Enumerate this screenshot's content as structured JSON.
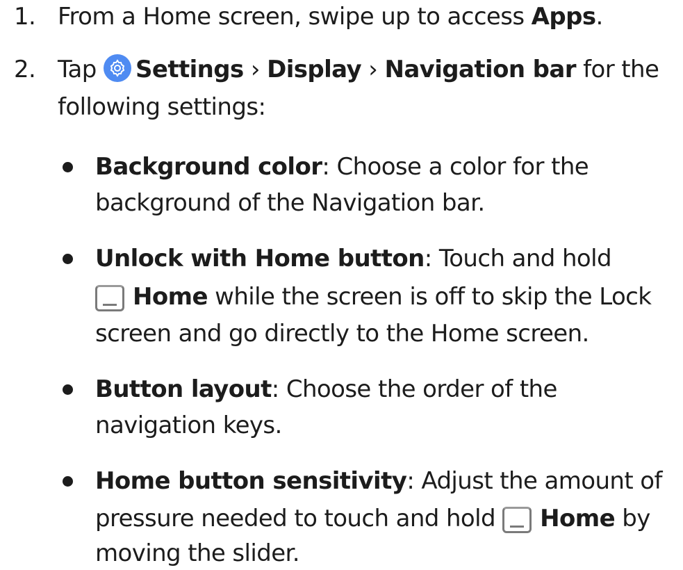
{
  "step1": {
    "number": "1.",
    "text_a": "From a Home screen, swipe up to access ",
    "apps": "Apps",
    "text_b": "."
  },
  "step2": {
    "number": "2.",
    "tap": "Tap ",
    "settings": "Settings",
    "sep1": " › ",
    "display": "Display",
    "sep2": " › ",
    "navigation_bar": "Navigation bar",
    "rest": " for the",
    "line2": "following settings:"
  },
  "bullets": {
    "background_color": {
      "term": "Background color",
      "l1_rest": ": Choose a color for the",
      "l2": "background of the Navigation bar."
    },
    "unlock_home": {
      "term": "Unlock with Home button",
      "l1_rest": ": Touch and hold",
      "home": "Home",
      "l2_rest": " while the screen is off to skip the Lock",
      "l3": "screen and go directly to the Home screen."
    },
    "button_layout": {
      "term": "Button layout",
      "l1_rest": ": Choose the order of the",
      "l2": "navigation keys."
    },
    "home_sensitivity": {
      "term": "Home button sensitivity",
      "l1_rest": ": Adjust the amount of",
      "l2_text": "pressure needed to touch and hold ",
      "home": "Home",
      "l2_rest": " by",
      "l3": "moving the slider."
    }
  },
  "colors": {
    "text": "#1c1c1c",
    "settings_icon_bg": "#4f8bf2",
    "home_key": "#7a7a7a"
  },
  "icons": [
    "settings-gear-icon",
    "home-key-icon"
  ]
}
